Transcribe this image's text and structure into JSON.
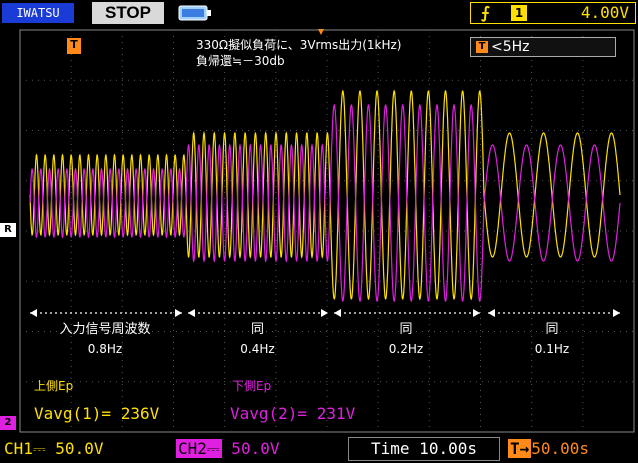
{
  "header": {
    "brand": "IWATSU",
    "run_status": "STOP",
    "trigger_channel": "1",
    "trigger_level": "4.00V"
  },
  "annotation": {
    "line1": "330Ω擬似負荷に、3Vrms出力(1kHz)",
    "line2": "負帰還≒－30db"
  },
  "freq_readout": "<5Hz",
  "segments": [
    {
      "label": "入力信号周波数",
      "freq": "0.8Hz"
    },
    {
      "label": "同",
      "freq": "0.4Hz"
    },
    {
      "label": "同",
      "freq": "0.2Hz"
    },
    {
      "label": "同",
      "freq": "0.1Hz"
    }
  ],
  "measurements": {
    "ch1_name": "上側Ep",
    "ch2_name": "下側Ep",
    "vavg1": "Vavg(1)= 236V",
    "vavg2": "Vavg(2)= 231V"
  },
  "footer": {
    "ch1": "CH1⎓  50.0V",
    "ch2_label": "CH2⎓",
    "ch2_value": " 50.0V",
    "timebase": "Time 10.00s",
    "delay": "50.00s"
  },
  "markers": {
    "ref": "R",
    "ch2": "2",
    "trig": "T"
  },
  "colors": {
    "ch1": "#ffe000",
    "ch2": "#e020e0",
    "grid": "#555555"
  }
}
